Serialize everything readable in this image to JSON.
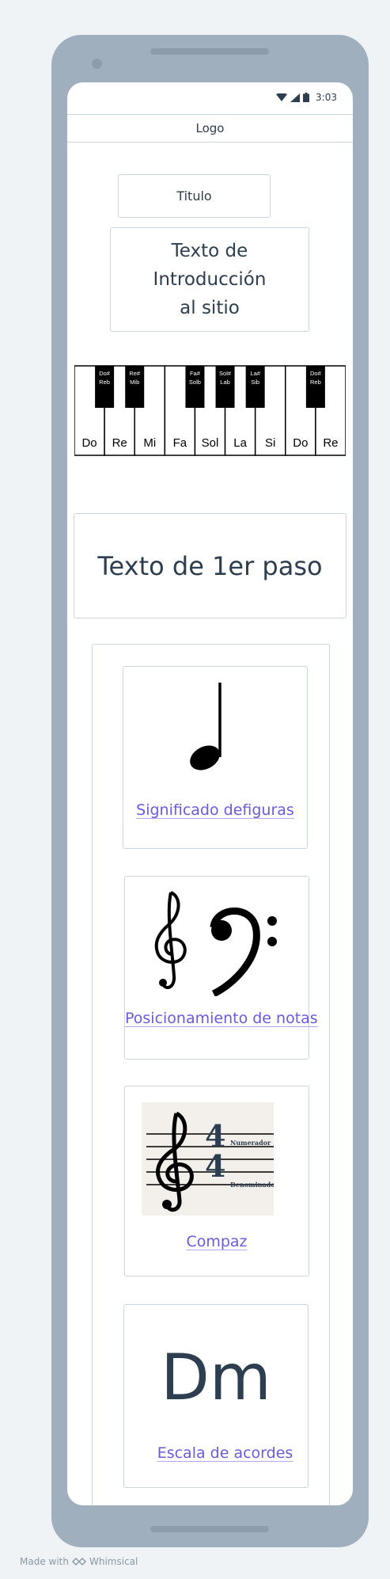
{
  "status_bar": {
    "time": "3:03",
    "icons": [
      "wifi-icon",
      "signal-icon",
      "battery-icon"
    ]
  },
  "header": {
    "logo": "Logo"
  },
  "hero": {
    "title": "Titulo",
    "intro": "Texto de\nIntroducción\nal sitio"
  },
  "piano": {
    "white_keys": [
      "Do",
      "Re",
      "Mi",
      "Fa",
      "Sol",
      "La",
      "Si",
      "Do",
      "Re"
    ],
    "black_keys": [
      {
        "top": "Do#",
        "bottom": "Reb"
      },
      {
        "top": "Re#",
        "bottom": "Mib"
      },
      {
        "top": "Fa#",
        "bottom": "Solb"
      },
      {
        "top": "Sol#",
        "bottom": "Lab"
      },
      {
        "top": "La#",
        "bottom": "Sib"
      },
      {
        "top": "Do#",
        "bottom": "Reb"
      }
    ]
  },
  "step": {
    "text": "Texto de 1er paso"
  },
  "cards": {
    "figures": {
      "link": "Significado defiguras",
      "icon": "quarter-note-icon"
    },
    "positions": {
      "link": "Posicionamiento de notas",
      "icon": "clefs-icon"
    },
    "compas": {
      "link": "Compaz",
      "icon": "time-signature-image",
      "numerator_label": "Numerador",
      "denominator_label": "Denominador"
    },
    "chords": {
      "link": "Escala de acordes",
      "symbol": "Dm"
    }
  },
  "footer": {
    "made_with": "Made with",
    "brand": "Whimsical"
  },
  "colors": {
    "frame": "#a0afbd",
    "border": "#c8d6e2",
    "link": "#6a5ae0",
    "text": "#2c3e50",
    "background": "#f0f3f6"
  }
}
